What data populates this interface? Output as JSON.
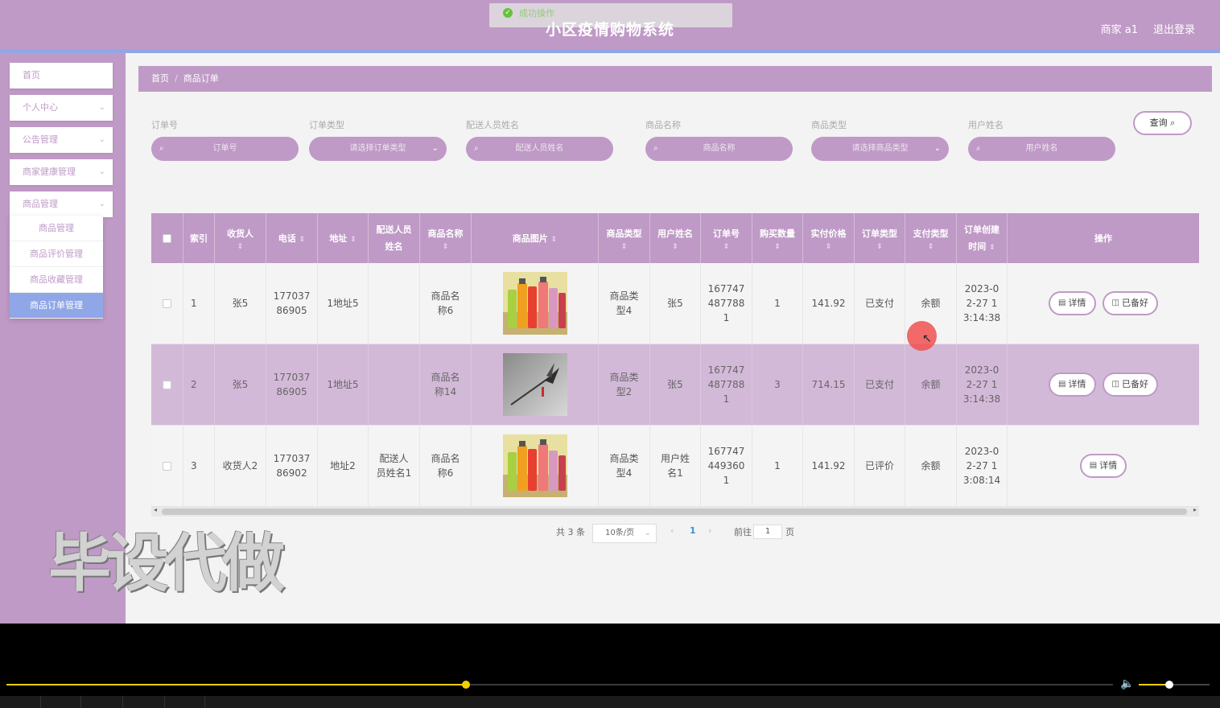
{
  "header": {
    "title": "小区疫情购物系统",
    "user_label": "商家 a1",
    "logout_label": "退出登录",
    "toast_message": "成功操作"
  },
  "sidebar": {
    "items": [
      {
        "label": "首页"
      },
      {
        "label": "个人中心"
      },
      {
        "label": "公告管理"
      },
      {
        "label": "商家健康管理"
      },
      {
        "label": "商品管理"
      }
    ],
    "submenu": [
      {
        "label": "商品管理"
      },
      {
        "label": "商品评价管理"
      },
      {
        "label": "商品收藏管理"
      },
      {
        "label": "商品订单管理"
      }
    ]
  },
  "breadcrumb": {
    "home": "首页",
    "current": "商品订单"
  },
  "search": {
    "fields": [
      {
        "label": "订单号",
        "placeholder": "订单号"
      },
      {
        "label": "订单类型",
        "placeholder": "请选择订单类型"
      },
      {
        "label": "配送人员姓名",
        "placeholder": "配送人员姓名"
      },
      {
        "label": "商品名称",
        "placeholder": "商品名称"
      },
      {
        "label": "商品类型",
        "placeholder": "请选择商品类型"
      },
      {
        "label": "用户姓名",
        "placeholder": "用户姓名"
      }
    ],
    "query_label": "查询"
  },
  "table": {
    "headers": [
      "索引",
      "收货人",
      "电话",
      "地址",
      "配送人员姓名",
      "商品名称",
      "商品图片",
      "商品类型",
      "用户姓名",
      "订单号",
      "购买数量",
      "实付价格",
      "订单类型",
      "支付类型",
      "订单创建时间",
      "操作"
    ],
    "rows": [
      {
        "index": "1",
        "receiver": "张5",
        "phone": "17703786905",
        "address": "1地址5",
        "courier": "",
        "product": "商品名称6",
        "image": "colorful-bottles",
        "type": "商品类型4",
        "username": "张5",
        "order_no": "1677474877881",
        "qty": "1",
        "price": "141.92",
        "order_type": "已支付",
        "pay_type": "余额",
        "created": "2023-02-27 13:14:38",
        "actions": [
          "详情",
          "已备好"
        ]
      },
      {
        "index": "2",
        "receiver": "张5",
        "phone": "17703786905",
        "address": "1地址5",
        "courier": "",
        "product": "商品名称14",
        "image": "garden-tool",
        "type": "商品类型2",
        "username": "张5",
        "order_no": "1677474877881",
        "qty": "3",
        "price": "714.15",
        "order_type": "已支付",
        "pay_type": "余额",
        "created": "2023-02-27 13:14:38",
        "actions": [
          "详情",
          "已备好"
        ]
      },
      {
        "index": "3",
        "receiver": "收货人2",
        "phone": "17703786902",
        "address": "地址2",
        "courier": "配送人员姓名1",
        "product": "商品名称6",
        "image": "colorful-bottles",
        "type": "商品类型4",
        "username": "用户姓名1",
        "order_no": "1677474493601",
        "qty": "1",
        "price": "141.92",
        "order_type": "已评价",
        "pay_type": "余额",
        "created": "2023-02-27 13:08:14",
        "actions": [
          "详情"
        ]
      }
    ]
  },
  "pagination": {
    "total_label": "共 3 条",
    "page_size": "10条/页",
    "current_page": "1",
    "goto_label": "前往",
    "goto_value": "1",
    "page_unit": "页"
  },
  "watermark": "毕设代做",
  "colors": {
    "theme": "#bf9ac6",
    "active": "#8fa7e6",
    "row_highlight": "#d3b9d8",
    "player_progress": "#f0d000"
  },
  "player": {
    "progress": 0.415,
    "volume": 0.43
  }
}
